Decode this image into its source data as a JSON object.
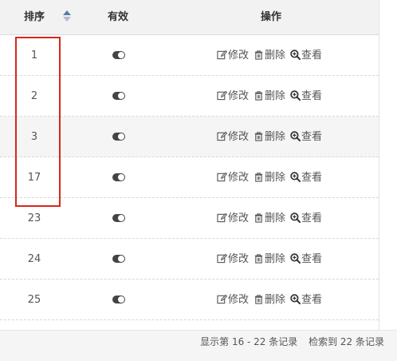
{
  "header": {
    "order_label": "排序",
    "valid_label": "有效",
    "ops_label": "操作"
  },
  "rows": [
    {
      "order": "1",
      "enabled": true,
      "edit": "修改",
      "delete": "删除",
      "view": "查看"
    },
    {
      "order": "2",
      "enabled": true,
      "edit": "修改",
      "delete": "删除",
      "view": "查看"
    },
    {
      "order": "3",
      "enabled": true,
      "edit": "修改",
      "delete": "删除",
      "view": "查看"
    },
    {
      "order": "17",
      "enabled": true,
      "edit": "修改",
      "delete": "删除",
      "view": "查看"
    },
    {
      "order": "23",
      "enabled": true,
      "edit": "修改",
      "delete": "删除",
      "view": "查看"
    },
    {
      "order": "24",
      "enabled": true,
      "edit": "修改",
      "delete": "删除",
      "view": "查看"
    },
    {
      "order": "25",
      "enabled": true,
      "edit": "修改",
      "delete": "删除",
      "view": "查看"
    }
  ],
  "footer": {
    "showing": "显示第 16 - 22 条记录",
    "total": "检索到 22 条记录"
  },
  "icons": {
    "edit": "edit-icon",
    "delete": "trash-icon",
    "view": "zoom-in-icon",
    "toggle": "toggle-on-icon",
    "sort": "sort-icon"
  },
  "colors": {
    "highlight": "#d9251d",
    "header_bg": "#f2f2f2",
    "alt_row_bg": "#f5f5f5",
    "sort_active": "#5b7ca8"
  }
}
